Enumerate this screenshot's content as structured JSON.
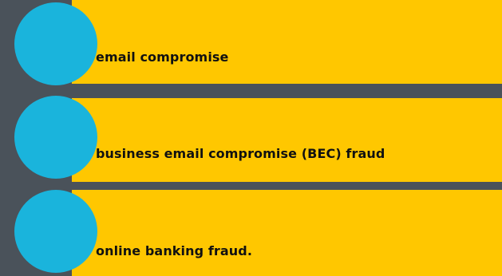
{
  "items": [
    {
      "label": "email compromise"
    },
    {
      "label": "business email compromise (BEC) fraud"
    },
    {
      "label": "online banking fraud."
    }
  ],
  "colors": {
    "background": "#4a525a",
    "card": "#ffc700",
    "circle": "#1ab4dc",
    "text": "#111111"
  }
}
